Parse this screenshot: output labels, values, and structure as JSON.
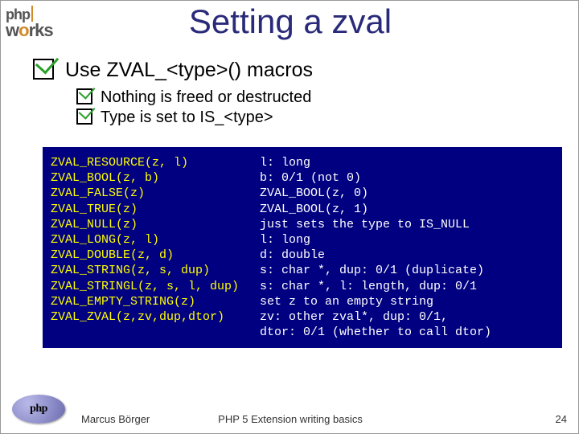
{
  "topLogo": {
    "line1": "php",
    "works_w": "w",
    "works_o": "o",
    "works_rks": "rks"
  },
  "title": "Setting a zval",
  "mainBullet": "Use ZVAL_<type>() macros",
  "subBullets": [
    "Nothing is freed or destructed",
    "Type is set to IS_<type>"
  ],
  "code": {
    "rows": [
      {
        "l": "ZVAL_RESOURCE(z, l)",
        "r": "l: long"
      },
      {
        "l": "ZVAL_BOOL(z, b)",
        "r": "b: 0/1 (not 0)"
      },
      {
        "l": "ZVAL_FALSE(z)",
        "r": "ZVAL_BOOL(z, 0)"
      },
      {
        "l": "ZVAL_TRUE(z)",
        "r": "ZVAL_BOOL(z, 1)"
      },
      {
        "l": "ZVAL_NULL(z)",
        "r": "just sets the type to IS_NULL"
      },
      {
        "l": "ZVAL_LONG(z, l)",
        "r": "l: long"
      },
      {
        "l": "ZVAL_DOUBLE(z, d)",
        "r": "d: double"
      },
      {
        "l": "ZVAL_STRING(z, s, dup)",
        "r": "s: char *, dup: 0/1 (duplicate)"
      },
      {
        "l": "ZVAL_STRINGL(z, s, l, dup)",
        "r": "s: char *, l: length, dup: 0/1"
      },
      {
        "l": "ZVAL_EMPTY_STRING(z)",
        "r": "set z to an empty string"
      },
      {
        "l": "ZVAL_ZVAL(z,zv,dup,dtor)",
        "r": "zv: other zval*, dup: 0/1,"
      },
      {
        "l": "",
        "r": "dtor: 0/1 (whether to call dtor)"
      }
    ]
  },
  "footer": {
    "author": "Marcus Börger",
    "mid": "PHP 5 Extension writing basics",
    "page": "24",
    "logoText": "php"
  }
}
